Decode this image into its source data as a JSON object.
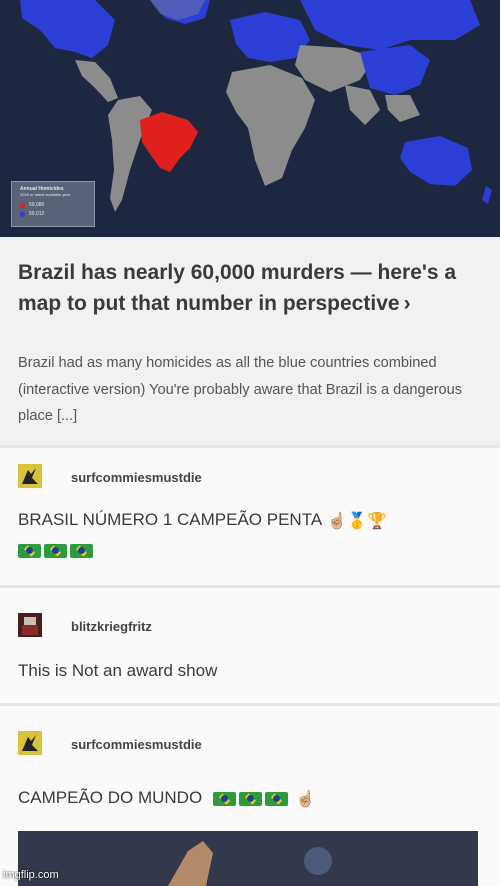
{
  "map": {
    "legend_title": "Annual Homicides",
    "legend_subtitle": "2015 or latest available year",
    "legend_red_value": "59,080",
    "legend_blue_value": "59,012",
    "colors": {
      "ocean": "#1d2740",
      "land": "#8c8c8c",
      "blue": "#2b3fd6",
      "red": "#e0201c"
    }
  },
  "article": {
    "headline": "Brazil has nearly 60,000 murders — here's a map to put that number in perspective",
    "summary": "Brazil had as many homicides as all the blue countries combined (interactive version) You're probably aware that Brazil is a dangerous place [...]"
  },
  "posts": [
    {
      "user": "surfcommiesmustdie",
      "text": "BRASIL NÚMERO 1 CAMPEÃO PENTA",
      "emoji": "☝🏼🥇🏆",
      "flags": 3
    },
    {
      "user": "blitzkriegfritz",
      "text": "This is Not an award show"
    },
    {
      "user": "surfcommiesmustdie",
      "text": "CAMPEÃO DO MUNDO",
      "emoji": "☝🏼",
      "flags": 3
    }
  ],
  "watermark": "imgflip.com"
}
